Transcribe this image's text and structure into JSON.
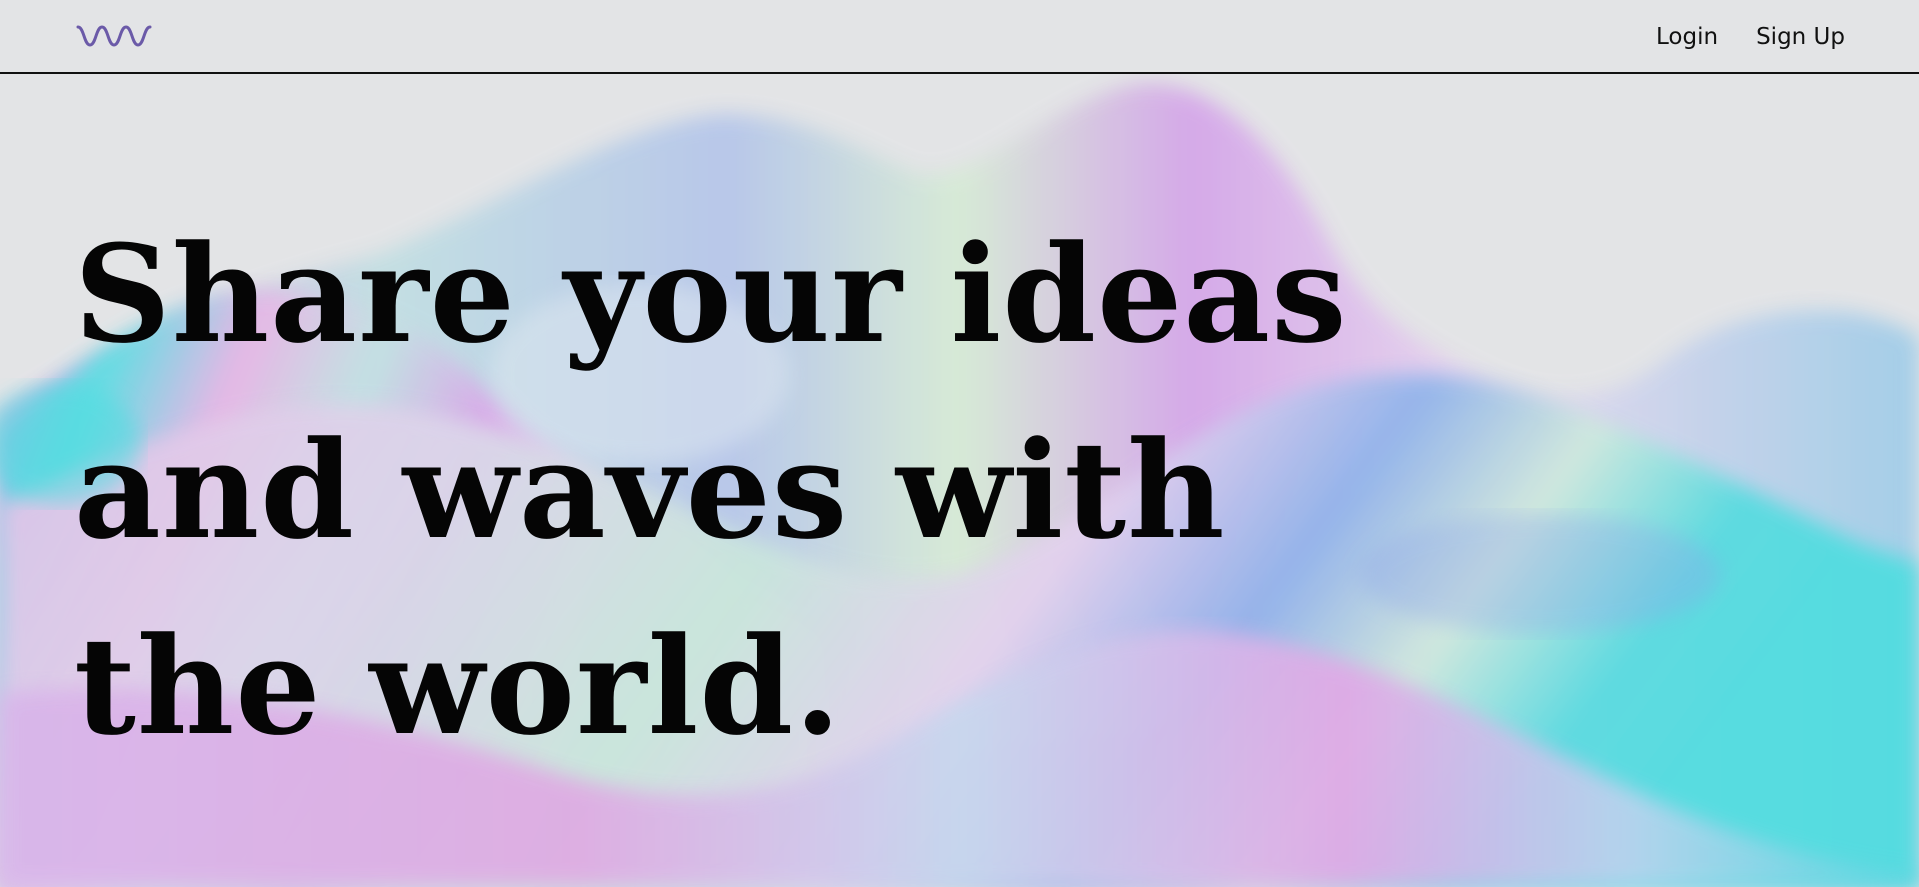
{
  "nav": {
    "logo_icon": "wave-logo-icon",
    "logo_color": "#6b5aa8",
    "links": [
      {
        "label": "Login"
      },
      {
        "label": "Sign Up"
      }
    ]
  },
  "hero": {
    "lines": [
      "Share your ideas",
      "and waves with",
      "the world."
    ]
  },
  "colors": {
    "background": "#e3e4e6",
    "text": "#050505",
    "accent_purple": "#c9a3e6",
    "accent_cyan": "#4fdde0",
    "accent_blue": "#8aa3e8"
  }
}
